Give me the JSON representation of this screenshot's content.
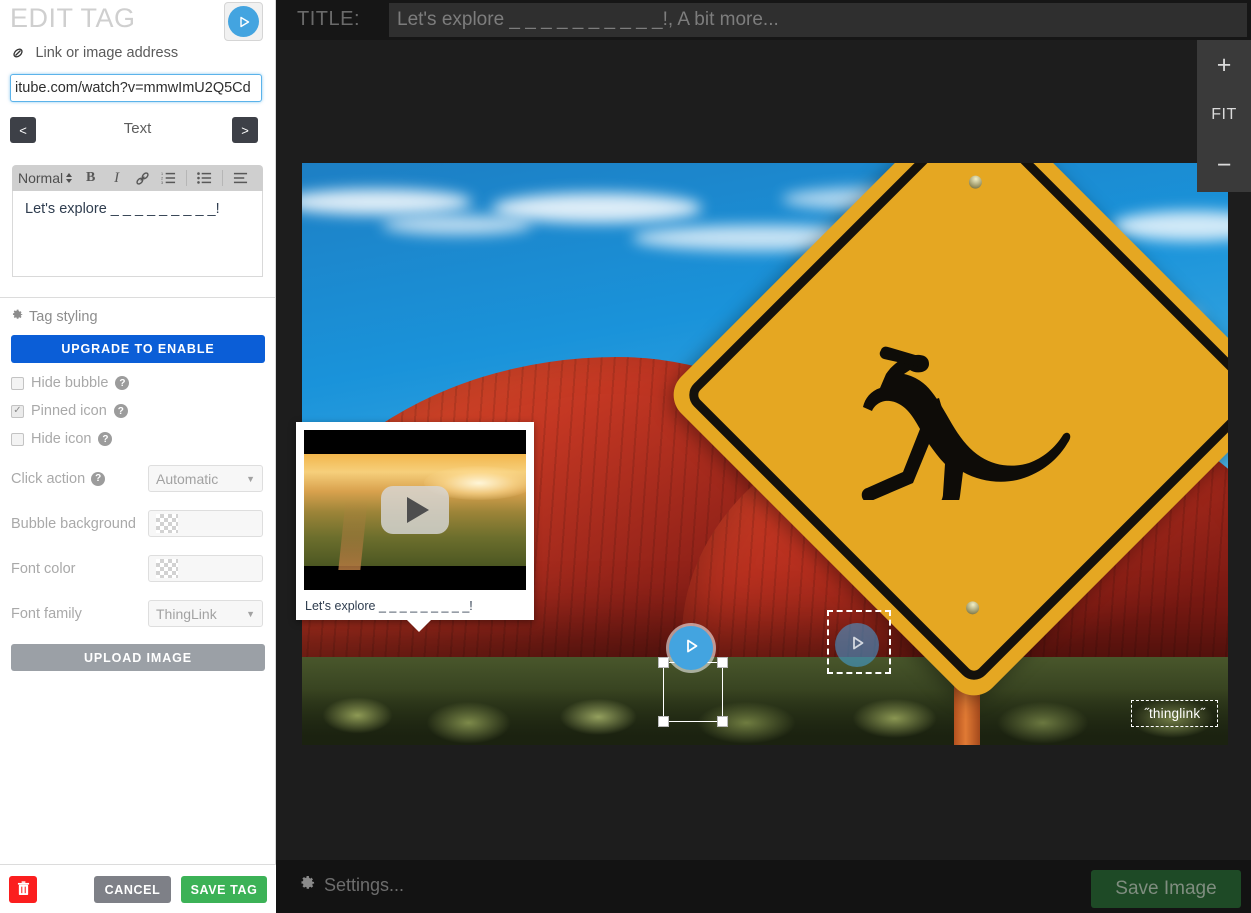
{
  "sidebar": {
    "title": "EDIT TAG",
    "tag_type_icon": "play-circle-icon",
    "link_field": {
      "icon": "link-icon",
      "label": "Link or image address",
      "value": "itube.com/watch?v=mmwImU2Q5Cd",
      "placeholder": "Link or image address"
    },
    "nav": {
      "prev_label": "<",
      "next_label": ">",
      "current_label": "Text"
    },
    "editor": {
      "format_label": "Normal",
      "buttons": [
        "bold-icon",
        "italic-icon",
        "link-icon",
        "ordered-list-icon",
        "bullet-list-icon",
        "align-icon"
      ],
      "content": "Let's explore _ _ _ _ _ _ _ _ _!"
    },
    "styling": {
      "section_label": "Tag styling",
      "section_icon": "gear-icon",
      "upgrade_label": "UPGRADE TO ENABLE",
      "checkboxes": [
        {
          "label": "Hide bubble",
          "checked": false,
          "help": "?"
        },
        {
          "label": "Pinned icon",
          "checked": true,
          "help": "?"
        },
        {
          "label": "Hide icon",
          "checked": false,
          "help": "?"
        }
      ],
      "click_action": {
        "label": "Click action",
        "value": "Automatic",
        "help": "?"
      },
      "bubble_background": {
        "label": "Bubble background",
        "value": ""
      },
      "font_color": {
        "label": "Font color",
        "value": ""
      },
      "font_family": {
        "label": "Font family",
        "value": "ThingLink"
      },
      "upload_label": "UPLOAD IMAGE"
    },
    "footer": {
      "delete_icon": "trash-icon",
      "cancel_label": "CANCEL",
      "save_label": "SAVE TAG"
    }
  },
  "main": {
    "title_label": "TITLE:",
    "title_value": "Let's explore _ _ _ _ _ _ _ _ _ _!, A bit more...",
    "zoom": {
      "in_label": "+",
      "fit_label": "FIT",
      "out_label": "−"
    },
    "preview": {
      "caption": "Let's explore _ _ _ _ _ _ _ _ _!",
      "play_icon": "youtube-play-icon"
    },
    "watermark": "˝thinglink˝",
    "tags": [
      {
        "name": "tag-marker-selected",
        "icon": "play-circle-icon",
        "selected": true
      },
      {
        "name": "tag-marker-secondary",
        "icon": "play-circle-icon",
        "selected": false
      }
    ],
    "bottom": {
      "settings_label": "Settings...",
      "settings_icon": "gear-icon",
      "save_image_label": "Save Image"
    }
  },
  "colors": {
    "accent_blue": "#43a4e0",
    "upgrade_blue": "#0b5ed7",
    "save_green": "#3cb257",
    "delete_red": "#fb1e1e",
    "cancel_gray": "#7e8087",
    "upload_gray": "#9ba0a6",
    "sidebar_bg": "#ffffff",
    "canvas_bg": "#1d1d1d",
    "titlebar_bg": "#161616",
    "sign_yellow": "#e5a722"
  }
}
